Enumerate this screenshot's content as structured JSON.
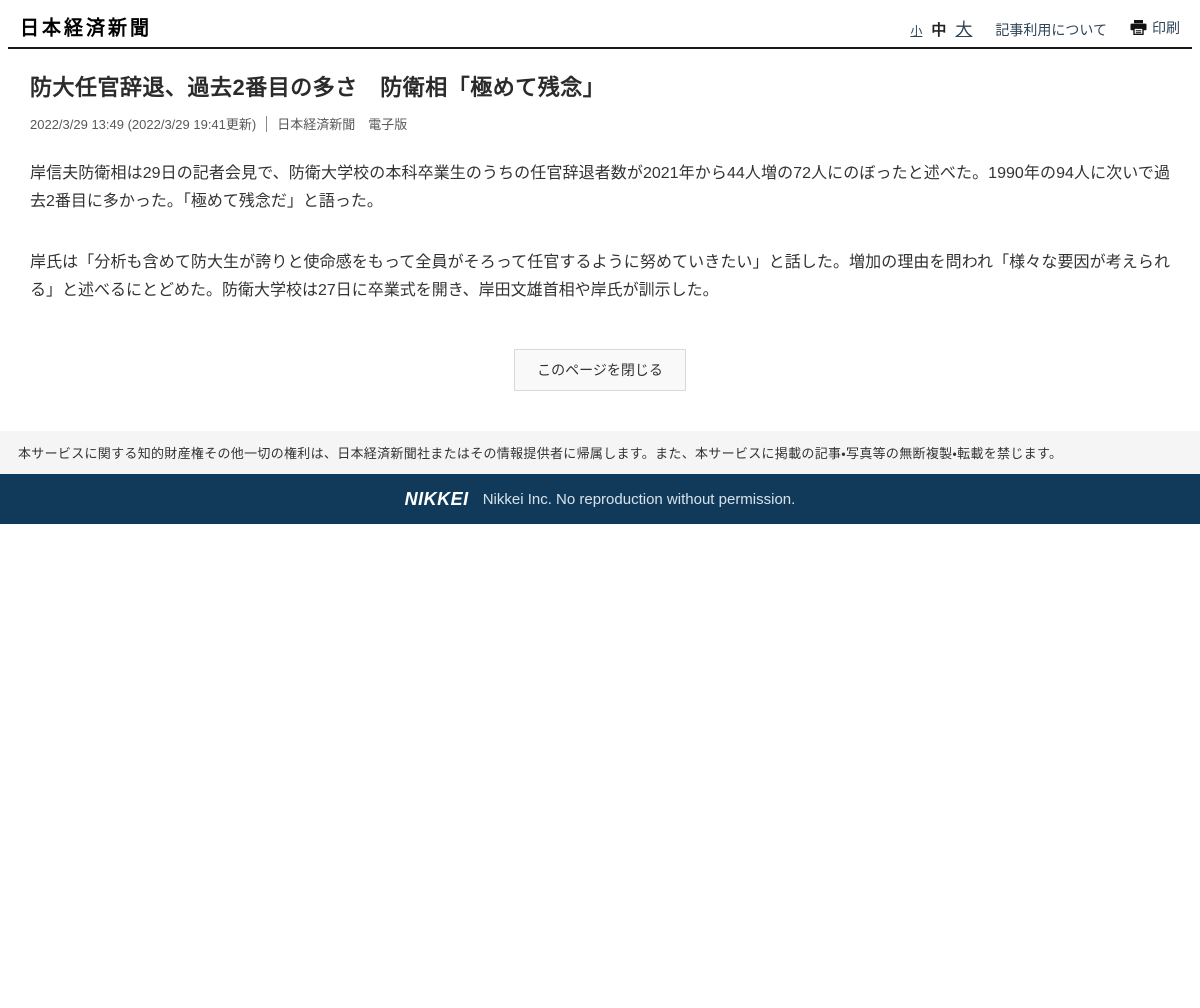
{
  "header": {
    "logo": "日本経済新聞",
    "font_small": "小",
    "font_medium": "中",
    "font_large": "大",
    "article_usage": "記事利用について",
    "print_label": "印刷"
  },
  "article": {
    "title": "防大任官辞退、過去2番目の多さ　防衛相「極めて残念」",
    "timestamp": "2022/3/29 13:49 (2022/3/29 19:41更新)",
    "source": "日本経済新聞　電子版",
    "paragraphs": [
      "岸信夫防衛相は29日の記者会見で、防衛大学校の本科卒業生のうちの任官辞退者数が2021年から44人増の72人にのぼったと述べた。1990年の94人に次いで過去2番目に多かった。「極めて残念だ」と語った。",
      "岸氏は「分析も含めて防大生が誇りと使命感をもって全員がそろって任官するように努めていきたい」と話した。増加の理由を問われ「様々な要因が考えられる」と述べるにとどめた。防衛大学校は27日に卒業式を開き、岸田文雄首相や岸氏が訓示した。"
    ],
    "close_button": "このページを閉じる"
  },
  "footer": {
    "disclaimer": "本サービスに関する知的財産権その他一切の権利は、日本経済新聞社またはその情報提供者に帰属します。また、本サービスに掲載の記事・写真等の無断複製・転載を禁じます。",
    "brand": "NIKKEI",
    "copyright": "Nikkei Inc. No reproduction without permission.",
    "bar_color": "#113a5a"
  }
}
